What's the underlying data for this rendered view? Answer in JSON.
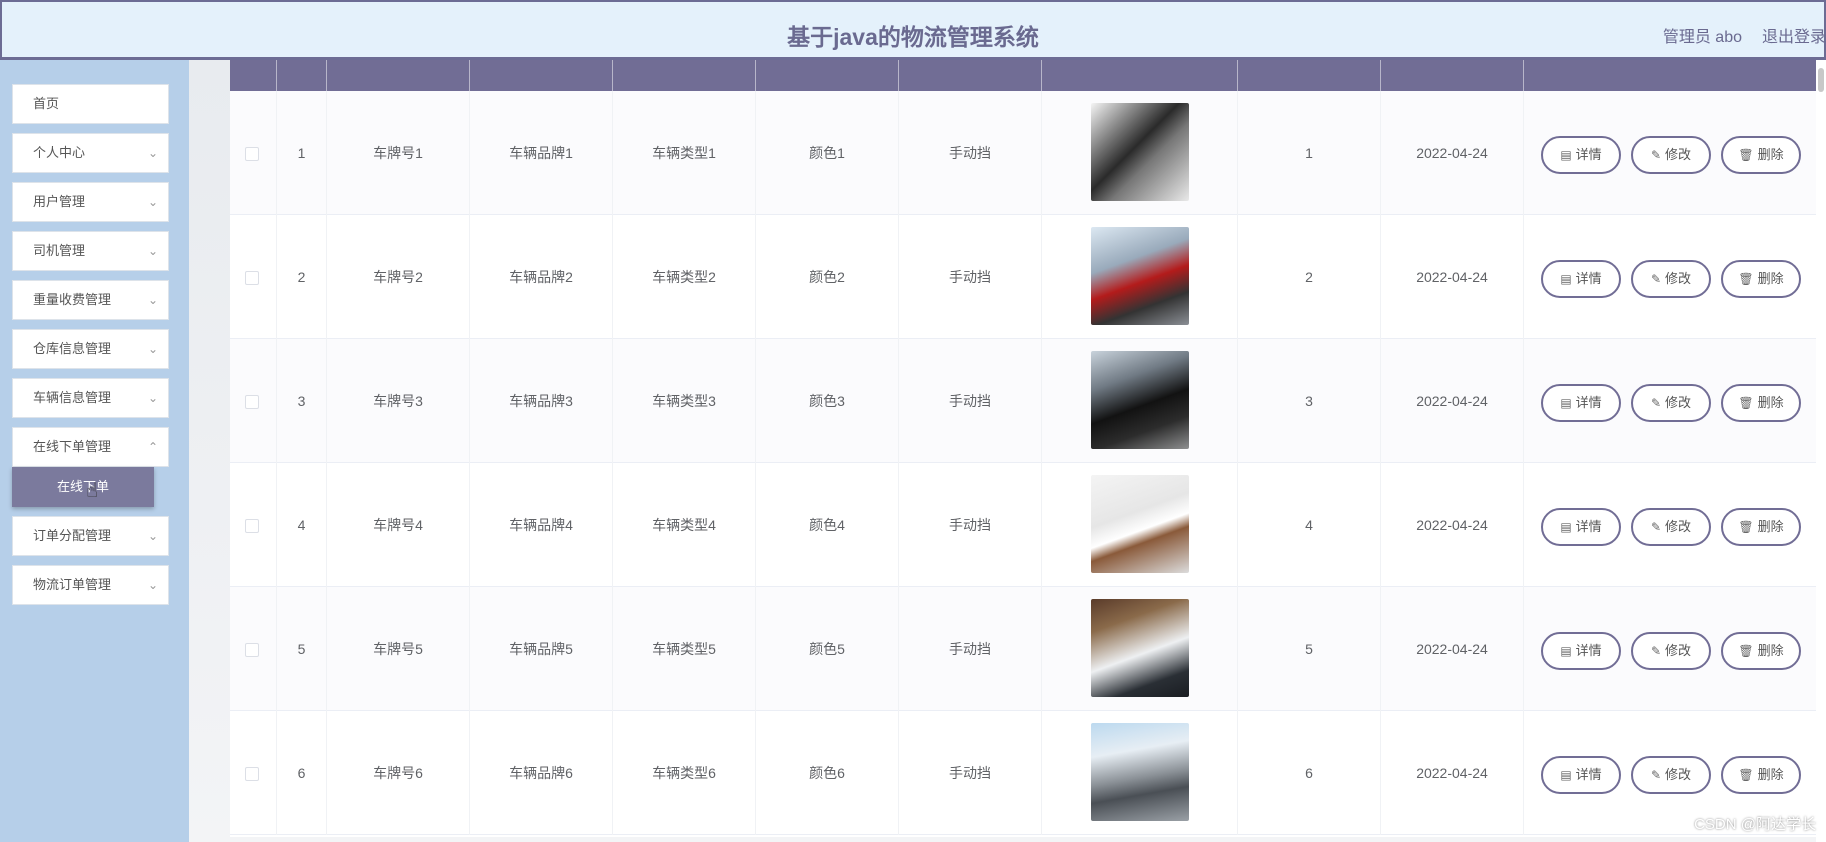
{
  "header": {
    "title": "基于java的物流管理系统",
    "user_label": "管理员 abo",
    "logout_label": "退出登录"
  },
  "sidebar": {
    "items": [
      {
        "label": "首页"
      },
      {
        "label": "个人中心"
      },
      {
        "label": "用户管理"
      },
      {
        "label": "司机管理"
      },
      {
        "label": "重量收费管理"
      },
      {
        "label": "仓库信息管理"
      },
      {
        "label": "车辆信息管理"
      },
      {
        "label": "在线下单管理"
      },
      {
        "label": "订单分配管理"
      },
      {
        "label": "物流订单管理"
      }
    ],
    "submenu_item": "在线下单"
  },
  "table": {
    "rows": [
      {
        "index": "1",
        "plate": "车牌号1",
        "brand": "车辆品牌1",
        "type": "车辆类型1",
        "color": "颜色1",
        "gear": "手动挡",
        "seats": "1",
        "date": "2022-04-24"
      },
      {
        "index": "2",
        "plate": "车牌号2",
        "brand": "车辆品牌2",
        "type": "车辆类型2",
        "color": "颜色2",
        "gear": "手动挡",
        "seats": "2",
        "date": "2022-04-24"
      },
      {
        "index": "3",
        "plate": "车牌号3",
        "brand": "车辆品牌3",
        "type": "车辆类型3",
        "color": "颜色3",
        "gear": "手动挡",
        "seats": "3",
        "date": "2022-04-24"
      },
      {
        "index": "4",
        "plate": "车牌号4",
        "brand": "车辆品牌4",
        "type": "车辆类型4",
        "color": "颜色4",
        "gear": "手动挡",
        "seats": "4",
        "date": "2022-04-24"
      },
      {
        "index": "5",
        "plate": "车牌号5",
        "brand": "车辆品牌5",
        "type": "车辆类型5",
        "color": "颜色5",
        "gear": "手动挡",
        "seats": "5",
        "date": "2022-04-24"
      },
      {
        "index": "6",
        "plate": "车牌号6",
        "brand": "车辆品牌6",
        "type": "车辆类型6",
        "color": "颜色6",
        "gear": "手动挡",
        "seats": "6",
        "date": "2022-04-24"
      }
    ],
    "actions": {
      "detail": "详情",
      "edit": "修改",
      "delete": "删除"
    }
  },
  "watermark": "CSDN @阿达学长",
  "colors": {
    "header_bg": "#e4f1fb",
    "accent": "#716d95",
    "sidebar_bg": "#b6cfe9",
    "submenu_bg": "#7b7a9d"
  }
}
